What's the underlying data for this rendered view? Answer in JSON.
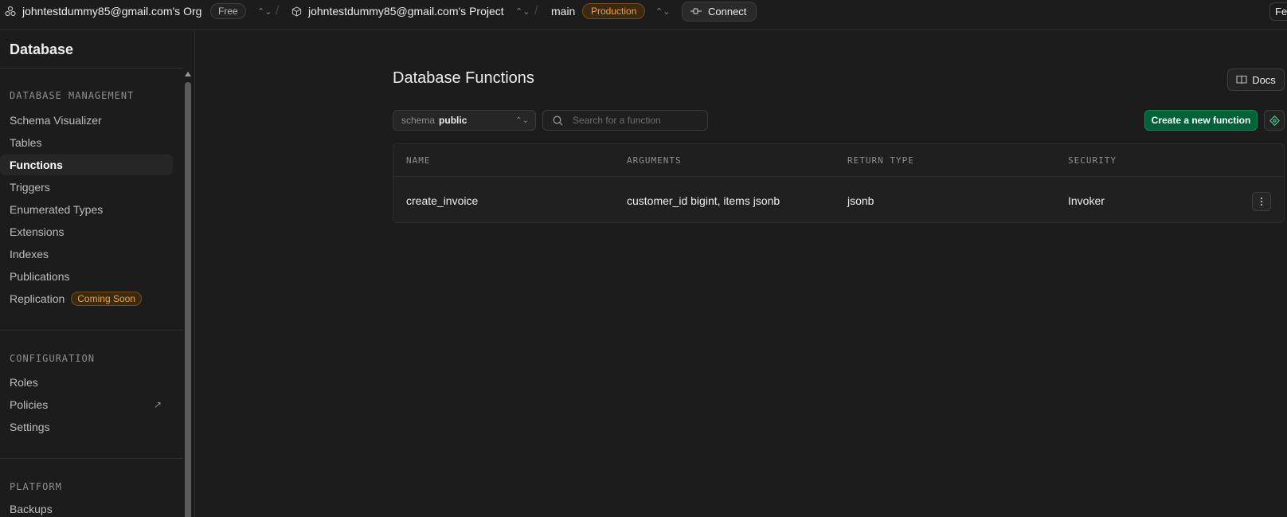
{
  "topbar": {
    "org_name": "johntestdummy85@gmail.com's Org",
    "org_plan": "Free",
    "project_name": "johntestdummy85@gmail.com's Project",
    "branch": "main",
    "env_badge": "Production",
    "connect_label": "Connect",
    "right_cutoff": "Fe"
  },
  "sidebar": {
    "title": "Database",
    "sections": {
      "management": "DATABASE MANAGEMENT",
      "configuration": "CONFIGURATION",
      "platform": "PLATFORM"
    },
    "management_items": [
      "Schema Visualizer",
      "Tables",
      "Functions",
      "Triggers",
      "Enumerated Types",
      "Extensions",
      "Indexes",
      "Publications",
      "Replication"
    ],
    "replication_badge": "Coming Soon",
    "configuration_items": [
      "Roles",
      "Policies",
      "Settings"
    ],
    "platform_items": [
      "Backups"
    ]
  },
  "main": {
    "title": "Database Functions",
    "docs_label": "Docs",
    "schema_label": "schema",
    "schema_value": "public",
    "search_placeholder": "Search for a function",
    "create_label": "Create a new function",
    "table": {
      "columns": [
        "NAME",
        "ARGUMENTS",
        "RETURN TYPE",
        "SECURITY"
      ],
      "rows": [
        {
          "name": "create_invoice",
          "arguments": "customer_id bigint, items jsonb",
          "return_type": "jsonb",
          "security": "Invoker"
        }
      ]
    }
  },
  "colors": {
    "background": "#1c1c1c",
    "accent_green": "#006239",
    "badge_orange": "#f0a13b"
  }
}
